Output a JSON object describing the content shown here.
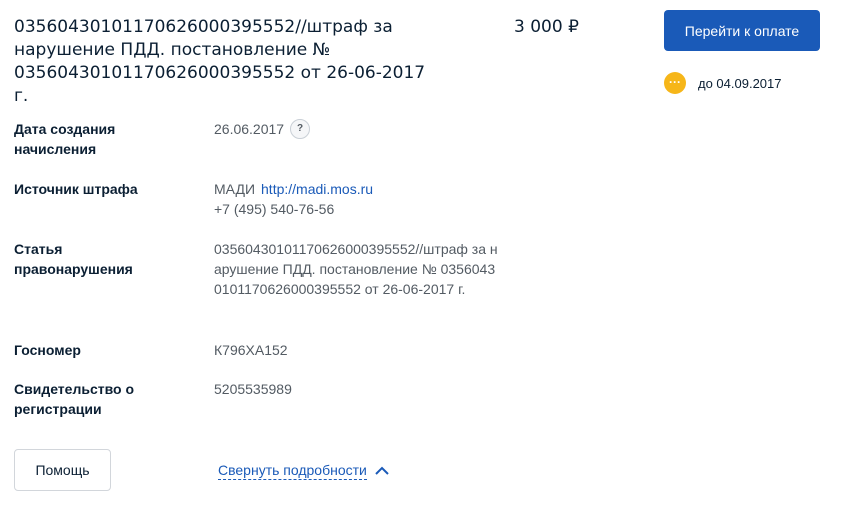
{
  "fine": {
    "title": "03560430101170626000395552//штраф за нарушение ПДД. постановление № 03560430101170626000395552 от 26-06-2017 г.",
    "amount": "3 000 ₽"
  },
  "payment": {
    "pay_label": "Перейти к оплате",
    "due_label": "до 04.09.2017",
    "due_icon_dots": "···",
    "due_icon_color": "#f6b619"
  },
  "details": {
    "created": {
      "label": "Дата создания начисления",
      "value": "26.06.2017",
      "help_icon": "?"
    },
    "source": {
      "label": "Источник штрафа",
      "name": "МАДИ",
      "link": "http://madi.mos.ru",
      "phone": "+7 (495) 540-76-56"
    },
    "article": {
      "label": "Статья правонарушения",
      "value": "03560430101170626000395552//штраф за нарушение ПДД. постановление № 03560430101170626000395552 от 26-06-2017 г."
    },
    "plate": {
      "label": "Госномер",
      "value": "К796ХА152"
    },
    "certificate": {
      "label": "Свидетельство о регистрации",
      "value": "5205535989"
    }
  },
  "footer": {
    "help_label": "Помощь",
    "collapse_label": "Свернуть подробности"
  },
  "colors": {
    "accent": "#1a5ab8",
    "warning": "#f6b619"
  }
}
